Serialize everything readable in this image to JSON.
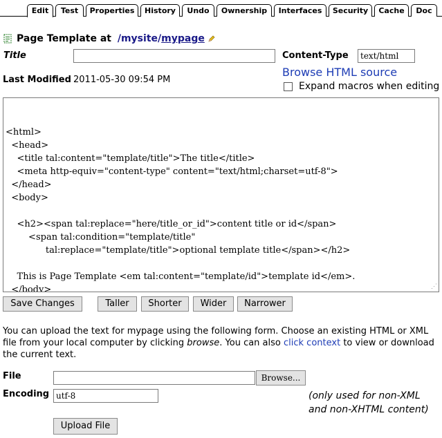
{
  "tabs": [
    {
      "label": "Edit",
      "active": true
    },
    {
      "label": "Test"
    },
    {
      "label": "Properties"
    },
    {
      "label": "History"
    },
    {
      "label": "Undo"
    },
    {
      "label": "Ownership"
    },
    {
      "label": "Interfaces"
    },
    {
      "label": "Security"
    },
    {
      "label": "Cache"
    },
    {
      "label": "Doc"
    }
  ],
  "header": {
    "prefix": "Page Template at",
    "sep1": "/",
    "folder": "mysite",
    "sep2": "/",
    "item": "mypage"
  },
  "form": {
    "title_label": "Title",
    "title_value": "",
    "content_type_label": "Content-Type",
    "content_type_value": "text/html",
    "last_modified_label": "Last Modified",
    "last_modified_value": "2011-05-30 09:54 PM",
    "browse_source_link": "Browse HTML source",
    "expand_macros_label": "Expand macros when editing",
    "editor_text": "<html>\n  <head>\n    <title tal:content=\"template/title\">The title</title>\n    <meta http-equiv=\"content-type\" content=\"text/html;charset=utf-8\">\n  </head>\n  <body>\n\n    <h2><span tal:replace=\"here/title_or_id\">content title or id</span>\n        <span tal:condition=\"template/title\"\n              tal:replace=\"template/title\">optional template title</span></h2>\n\n    This is Page Template <em tal:content=\"template/id\">template id</em>.\n  </body>\n</html>"
  },
  "buttons": {
    "save": "Save Changes",
    "taller": "Taller",
    "shorter": "Shorter",
    "wider": "Wider",
    "narrower": "Narrower"
  },
  "upload": {
    "info_part1": "You can upload the text for mypage using the following form. Choose an existing HTML or XML file from your local computer by clicking ",
    "info_browse": "browse",
    "info_part2": ". You can also ",
    "info_link": "click context",
    "info_part3": " to view or download the current text.",
    "file_label": "File",
    "browse_button": "Browse...",
    "encoding_label": "Encoding",
    "encoding_value": "utf-8",
    "note_line1": "(only used for non-XML",
    "note_line2": "and non-XHTML content)",
    "upload_button": "Upload File"
  }
}
